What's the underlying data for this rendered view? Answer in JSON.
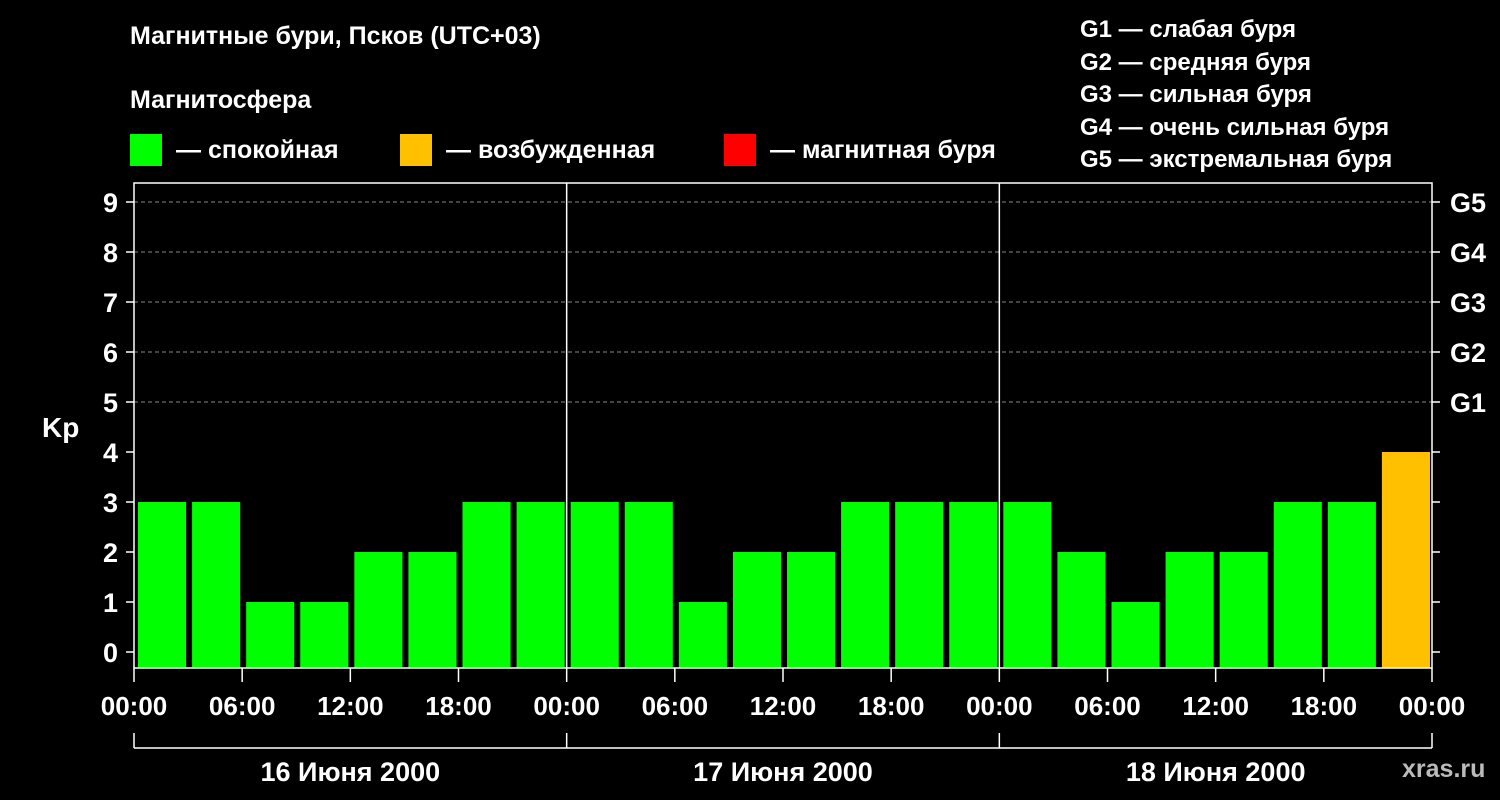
{
  "title": "Магнитные бури, Псков (UTC+03)",
  "subtitle": "Магнитосфера",
  "legend": [
    {
      "label": "— спокойная",
      "color": "#00ff00"
    },
    {
      "label": "— возбужденная",
      "color": "#ffc000"
    },
    {
      "label": "— магнитная буря",
      "color": "#ff0000"
    }
  ],
  "storm_levels": [
    "G1 — слабая буря",
    "G2 — средняя буря",
    "G3 — сильная буря",
    "G4 — очень сильная буря",
    "G5 — экстремальная буря"
  ],
  "watermark": "xras.ru",
  "chart_data": {
    "type": "bar",
    "ylabel": "Kp",
    "ylim": [
      0,
      9
    ],
    "yticks": [
      0,
      1,
      2,
      3,
      4,
      5,
      6,
      7,
      8,
      9
    ],
    "right_axis_labels": [
      {
        "kp": 5,
        "label": "G1"
      },
      {
        "kp": 6,
        "label": "G2"
      },
      {
        "kp": 7,
        "label": "G3"
      },
      {
        "kp": 8,
        "label": "G4"
      },
      {
        "kp": 9,
        "label": "G5"
      }
    ],
    "grid": "horizontal dashed at Kp 5–9",
    "x_tick_labels": [
      "00:00",
      "06:00",
      "12:00",
      "18:00",
      "00:00",
      "06:00",
      "12:00",
      "18:00",
      "00:00",
      "06:00",
      "12:00",
      "18:00",
      "00:00"
    ],
    "days": [
      "16 Июня 2000",
      "17 Июня 2000",
      "18 Июня 2000"
    ],
    "interval_hours": 3,
    "series": [
      {
        "values": [
          3,
          3,
          1,
          1,
          2,
          2,
          3,
          3,
          3,
          3,
          1,
          2,
          2,
          3,
          3,
          3,
          3,
          2,
          1,
          2,
          2,
          3,
          3,
          4
        ]
      }
    ],
    "colors": {
      "quiet": "#00ff00",
      "active": "#ffc000",
      "storm": "#ff0000"
    }
  }
}
